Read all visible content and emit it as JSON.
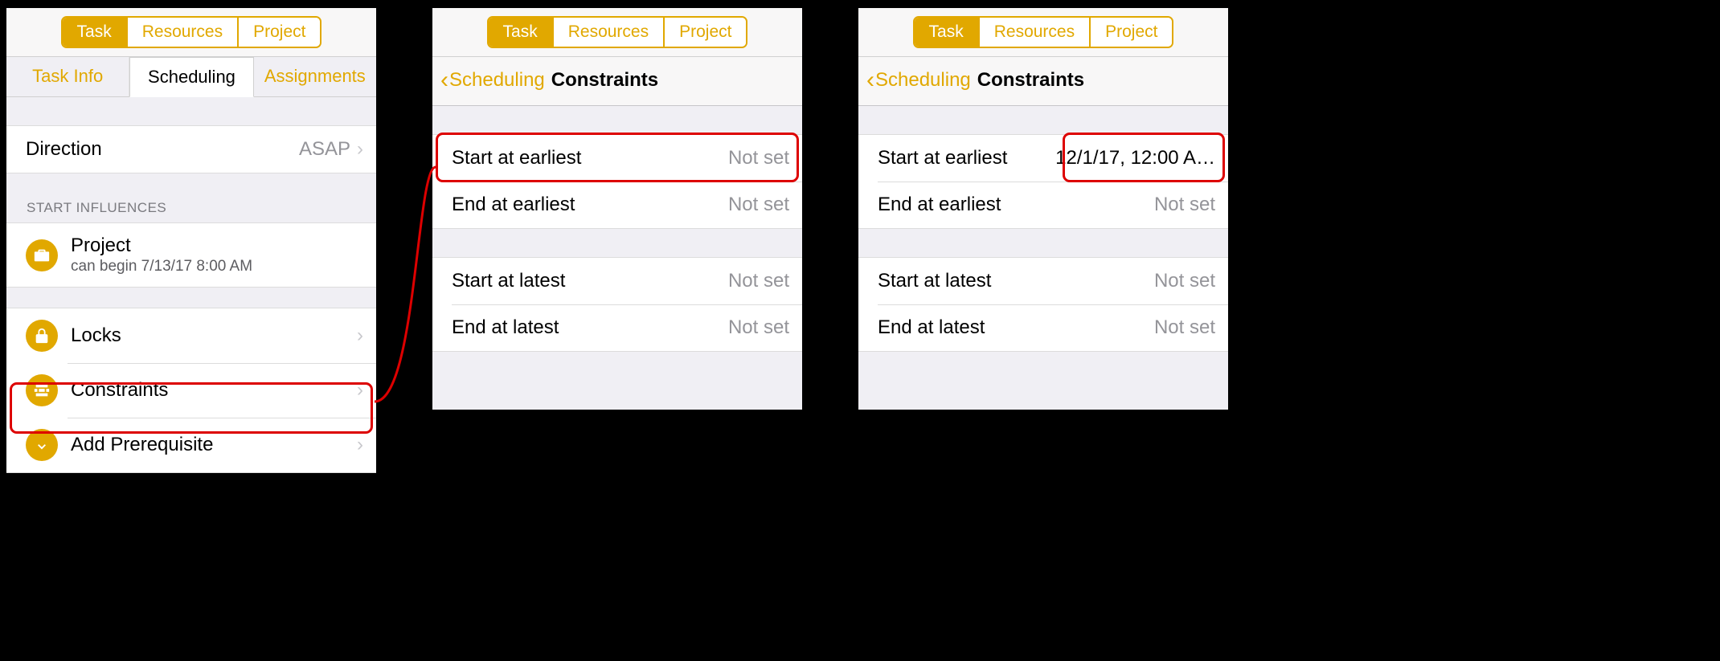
{
  "segmented": {
    "task": "Task",
    "resources": "Resources",
    "project": "Project"
  },
  "tabs": {
    "taskinfo": "Task Info",
    "scheduling": "Scheduling",
    "assignments": "Assignments"
  },
  "direction": {
    "label": "Direction",
    "value": "ASAP"
  },
  "start_influences_header": "START INFLUENCES",
  "project_influence": {
    "label": "Project",
    "sub": "can begin 7/13/17 8:00 AM"
  },
  "locks_label": "Locks",
  "constraints_label": "Constraints",
  "add_prereq_label": "Add Prerequisite",
  "nav": {
    "back": "Scheduling",
    "title": "Constraints"
  },
  "constraints": {
    "start_earliest": "Start at earliest",
    "end_earliest": "End at earliest",
    "start_latest": "Start at latest",
    "end_latest": "End at latest",
    "not_set": "Not set",
    "date_value": "12/1/17, 12:00 A…"
  }
}
